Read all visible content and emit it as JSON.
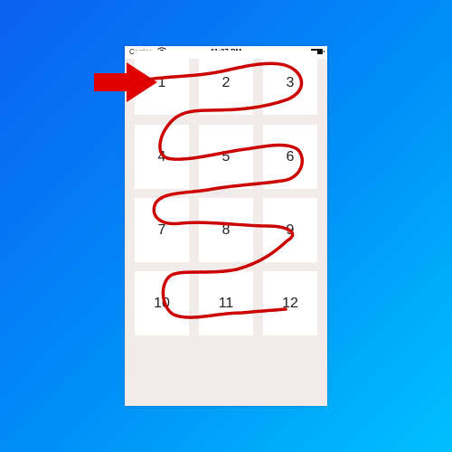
{
  "status_bar": {
    "carrier": "Carrier",
    "time": "11:37 PM"
  },
  "grid": {
    "cells": [
      "1",
      "2",
      "3",
      "4",
      "5",
      "6",
      "7",
      "8",
      "9",
      "10",
      "11",
      "12"
    ]
  },
  "annotation": {
    "arrow_color": "#e00000",
    "path_color": "#cc0000"
  }
}
